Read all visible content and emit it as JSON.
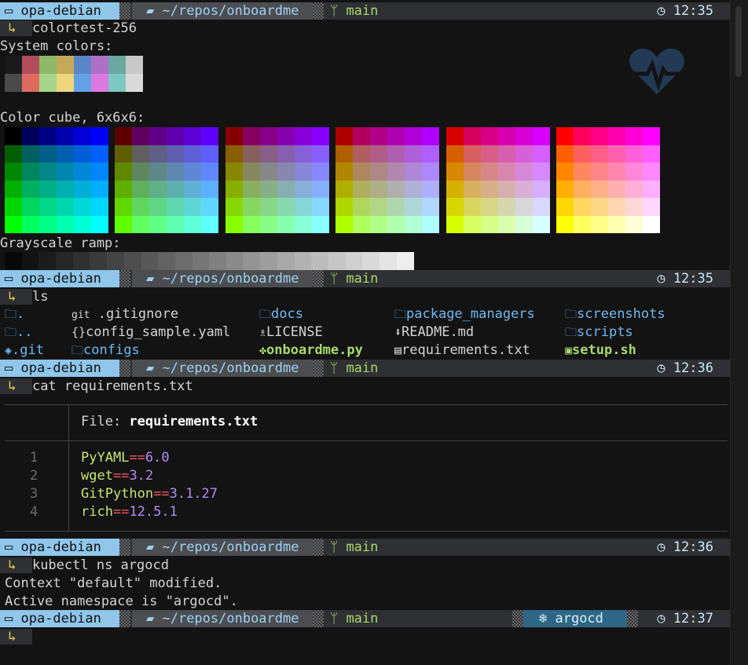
{
  "prompt": {
    "host": "opa-debian",
    "path": "~/repos/onboardme",
    "branch": "main",
    "kube_ns": "argocd"
  },
  "blocks": [
    {
      "time": "12:35",
      "command": "colortest-256"
    },
    {
      "time": "12:35",
      "command": "ls"
    },
    {
      "time": "12:36",
      "command": "cat requirements.txt"
    },
    {
      "time": "12:36",
      "command": "kubectl ns argocd"
    },
    {
      "time": "12:37",
      "command": ""
    }
  ],
  "colortest": {
    "system_label": "System colors:",
    "cube_label": "Color cube, 6x6x6:",
    "gray_label": "Grayscale ramp:",
    "system_row1": [
      "#1a1a1a",
      "#b34d5b",
      "#8fb866",
      "#c3a95a",
      "#5a86c8",
      "#b06fc6",
      "#6ba8a2",
      "#c8c8c8"
    ],
    "system_row2": [
      "#4a4a4a",
      "#df6a5f",
      "#a5d58a",
      "#eed77a",
      "#63a1e5",
      "#dc79e0",
      "#7dc8c4",
      "#dadada"
    ]
  },
  "ls": {
    "columns": [
      [
        {
          "icon": "folder-icon",
          "name": ".",
          "kind": "dir"
        },
        {
          "icon": "folder-icon",
          "name": "..",
          "kind": "dir"
        },
        {
          "icon": "git-icon",
          "name": ".git",
          "kind": "dir"
        }
      ],
      [
        {
          "icon": "git-text-icon",
          "name": ".gitignore",
          "kind": "file"
        },
        {
          "icon": "braces-icon",
          "name": "config_sample.yaml",
          "kind": "file"
        },
        {
          "icon": "folder-icon",
          "name": "configs",
          "kind": "dir"
        }
      ],
      [
        {
          "icon": "folder-icon",
          "name": "docs",
          "kind": "dir"
        },
        {
          "icon": "license-icon",
          "name": "LICENSE",
          "kind": "file"
        },
        {
          "icon": "python-icon",
          "name": "onboardme.py",
          "kind": "exe"
        }
      ],
      [
        {
          "icon": "folder-icon",
          "name": "package_managers",
          "kind": "dir"
        },
        {
          "icon": "download-icon",
          "name": "README.md",
          "kind": "file"
        },
        {
          "icon": "file-icon",
          "name": "requirements.txt",
          "kind": "file"
        }
      ],
      [
        {
          "icon": "folder-icon",
          "name": "screenshots",
          "kind": "dir"
        },
        {
          "icon": "folder-icon",
          "name": "scripts",
          "kind": "dir"
        },
        {
          "icon": "terminal-icon",
          "name": "setup.sh",
          "kind": "exe"
        }
      ]
    ]
  },
  "cat": {
    "file_label": "File: ",
    "file_name": "requirements.txt",
    "lines": [
      {
        "n": "1",
        "pkg": "PyYAML",
        "op": "==",
        "ver": "6.0"
      },
      {
        "n": "2",
        "pkg": "wget",
        "op": "==",
        "ver": "3.2"
      },
      {
        "n": "3",
        "pkg": "GitPython",
        "op": "==",
        "ver": "3.1.27"
      },
      {
        "n": "4",
        "pkg": "rich",
        "op": "==",
        "ver": "12.5.1"
      }
    ]
  },
  "kubectl": {
    "out1": "Context \"default\" modified.",
    "out2": "Active namespace is \"argocd\"."
  },
  "colors": {
    "accent": "#8fc6ea",
    "branch": "#a9d86a",
    "prompt_arrow": "#e5d34b"
  }
}
